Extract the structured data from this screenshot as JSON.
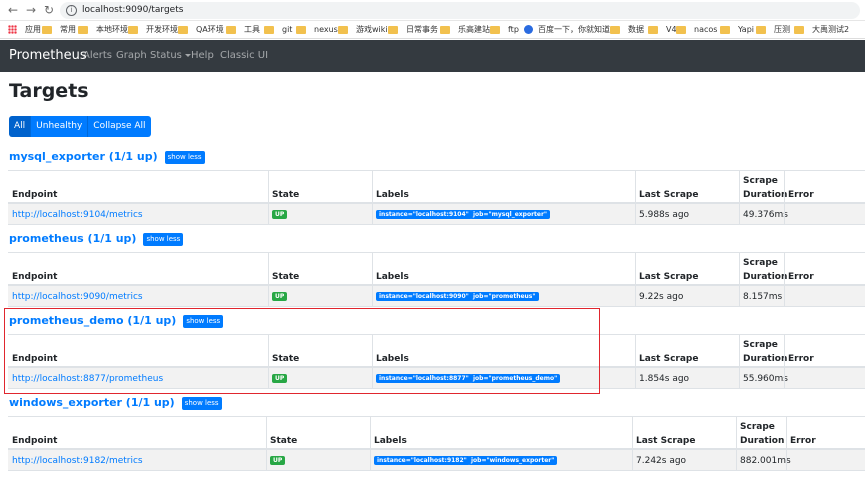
{
  "browser": {
    "url": "localhost:9090/targets",
    "bookmarks": [
      "应用",
      "常用",
      "本地环境",
      "开发环境",
      "QA环境",
      "工具",
      "git",
      "nexus",
      "游戏wiki",
      "日常事务",
      "乐高建站",
      "ftp",
      "百度一下，你就知道",
      "数据",
      "V4",
      "nacos",
      "Yapi",
      "压测",
      "大禹测试2"
    ]
  },
  "navbar": {
    "brand": "Prometheus",
    "links": [
      "Alerts",
      "Graph",
      "Status",
      "Help",
      "Classic UI"
    ]
  },
  "page": {
    "title": "Targets",
    "filters": [
      "All",
      "Unhealthy",
      "Collapse All"
    ],
    "active_filter": "All"
  },
  "table_headers": {
    "endpoint": "Endpoint",
    "state": "State",
    "labels": "Labels",
    "last_scrape": "Last Scrape",
    "scrape_duration_1": "Scrape",
    "scrape_duration_2": "Duration",
    "error": "Error"
  },
  "sections": [
    {
      "title": "mysql_exporter (1/1 up)",
      "toggle": "show less",
      "endpoint": "http://localhost:9104/metrics",
      "state": "UP",
      "labels": [
        "instance=\"localhost:9104\"",
        "job=\"mysql_exporter\""
      ],
      "last_scrape": "5.988s ago",
      "scrape_duration": "49.376ms",
      "error": ""
    },
    {
      "title": "prometheus (1/1 up)",
      "toggle": "show less",
      "endpoint": "http://localhost:9090/metrics",
      "state": "UP",
      "labels": [
        "instance=\"localhost:9090\"",
        "job=\"prometheus\""
      ],
      "last_scrape": "9.22s ago",
      "scrape_duration": "8.157ms",
      "error": ""
    },
    {
      "title": "prometheus_demo (1/1 up)",
      "toggle": "show less",
      "endpoint": "http://localhost:8877/prometheus",
      "state": "UP",
      "labels": [
        "instance=\"localhost:8877\"",
        "job=\"prometheus_demo\""
      ],
      "last_scrape": "1.854s ago",
      "scrape_duration": "55.960ms",
      "error": ""
    },
    {
      "title": "windows_exporter (1/1 up)",
      "toggle": "show less",
      "endpoint": "http://localhost:9182/metrics",
      "state": "UP",
      "labels": [
        "instance=\"localhost:9182\"",
        "job=\"windows_exporter\""
      ],
      "last_scrape": "7.242s ago",
      "scrape_duration": "882.001ms",
      "error": ""
    }
  ],
  "colors": {
    "accent": "#007bff",
    "navbar": "#343a40",
    "up": "#28a745",
    "highlight": "#e0262e"
  }
}
